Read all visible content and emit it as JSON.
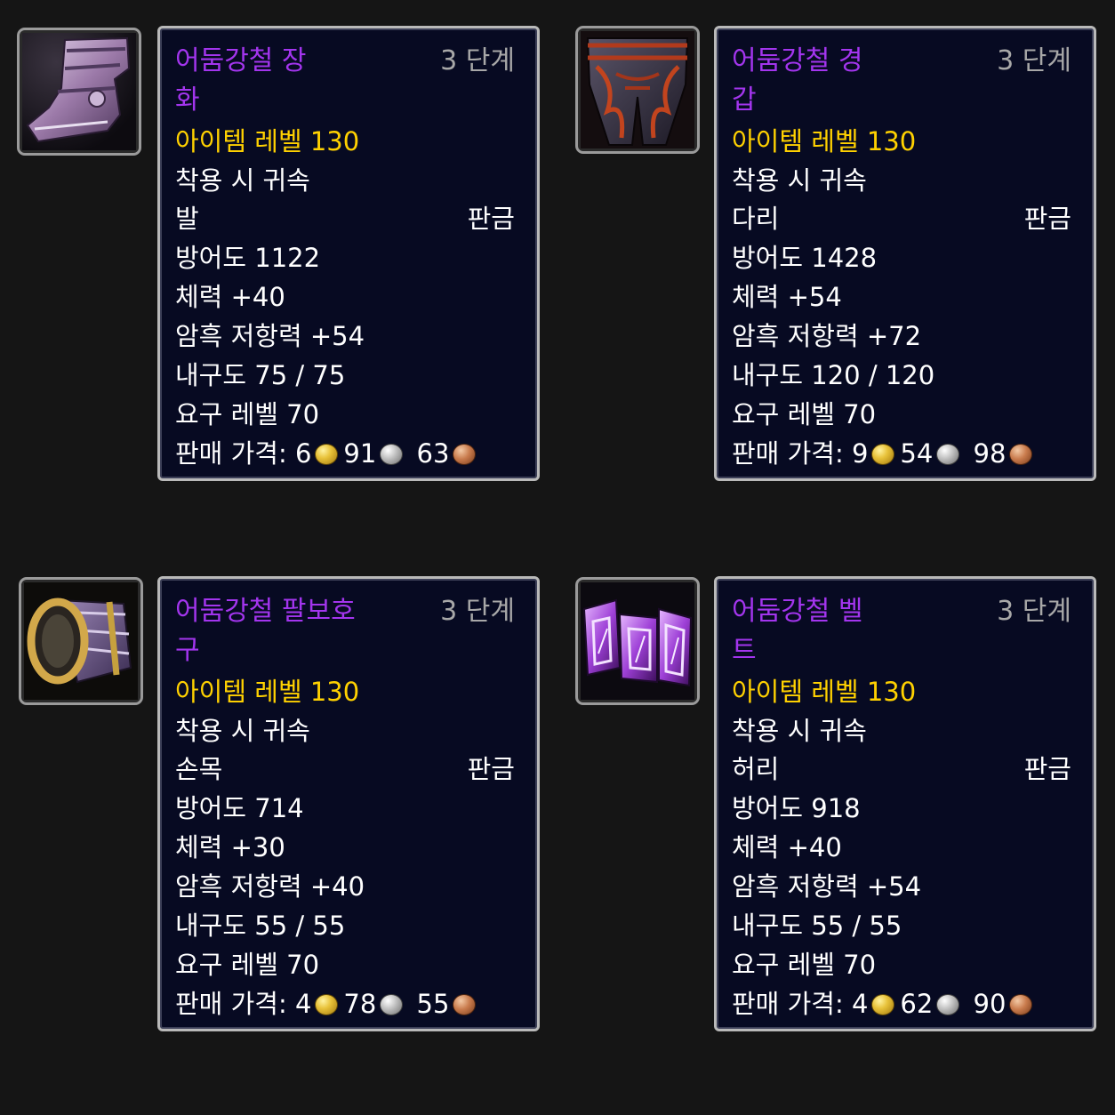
{
  "items": [
    {
      "name_line1": "어둠강철 장",
      "name_line2": "화",
      "tier": "3 단계",
      "item_level": "아이템 레벨 130",
      "binding": "착용 시 귀속",
      "slot": "발",
      "armor_type": "판금",
      "armor": "방어도 1122",
      "stamina": "체력 +40",
      "shadow_resist": "암흑 저항력 +54",
      "durability": "내구도 75 / 75",
      "required_level": "요구 레벨 70",
      "price_label": "판매 가격:",
      "gold": "6",
      "silver": "91",
      "copper": "63",
      "icon": "plate-boots-icon"
    },
    {
      "name_line1": "어둠강철 경",
      "name_line2": "갑",
      "tier": "3 단계",
      "item_level": "아이템 레벨 130",
      "binding": "착용 시 귀속",
      "slot": "다리",
      "armor_type": "판금",
      "armor": "방어도 1428",
      "stamina": "체력 +54",
      "shadow_resist": "암흑 저항력 +72",
      "durability": "내구도 120 / 120",
      "required_level": "요구 레벨 70",
      "price_label": "판매 가격:",
      "gold": "9",
      "silver": "54",
      "copper": "98",
      "icon": "plate-leggings-icon"
    },
    {
      "name_line1": "어둠강철 팔보호",
      "name_line2": "구",
      "tier": "3 단계",
      "item_level": "아이템 레벨 130",
      "binding": "착용 시 귀속",
      "slot": "손목",
      "armor_type": "판금",
      "armor": "방어도 714",
      "stamina": "체력 +30",
      "shadow_resist": "암흑 저항력 +40",
      "durability": "내구도 55 / 55",
      "required_level": "요구 레벨 70",
      "price_label": "판매 가격:",
      "gold": "4",
      "silver": "78",
      "copper": "55",
      "icon": "plate-bracer-icon"
    },
    {
      "name_line1": "어둠강철 벨",
      "name_line2": "트",
      "tier": "3 단계",
      "item_level": "아이템 레벨 130",
      "binding": "착용 시 귀속",
      "slot": "허리",
      "armor_type": "판금",
      "armor": "방어도 918",
      "stamina": "체력 +40",
      "shadow_resist": "암흑 저항력 +54",
      "durability": "내구도 55 / 55",
      "required_level": "요구 레벨 70",
      "price_label": "판매 가격:",
      "gold": "4",
      "silver": "62",
      "copper": "90",
      "icon": "plate-belt-icon"
    }
  ],
  "colors": {
    "epic_name": "#a335ee",
    "item_level": "#ffd100",
    "tier": "#a8a8a8",
    "tooltip_bg": "#070a22"
  }
}
